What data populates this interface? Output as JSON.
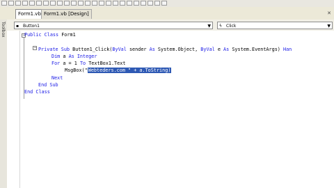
{
  "tabs": [
    {
      "label": "Form1.vb"
    },
    {
      "label": "Form1.vb [Design]"
    }
  ],
  "toolbox": {
    "label": "Toolbox"
  },
  "nav": {
    "left_combo": "Button1",
    "right_combo": "Click"
  },
  "code": {
    "l1_kw": "Public Class",
    "l1_tx": " Form1",
    "l2_kw1": "Private Sub",
    "l2_tx1": " Button1_Click(",
    "l2_kw2": "ByVal",
    "l2_tx2": " sender ",
    "l2_kw3": "As",
    "l2_tx3": " System.Object, ",
    "l2_kw4": "ByVal",
    "l2_tx4": " e ",
    "l2_kw5": "As",
    "l2_tx5": " System.EventArgs) ",
    "l2_kw6": "Han",
    "l3_kw1": "Dim",
    "l3_tx1": " a ",
    "l3_kw2": "As Integer",
    "l4_kw1": "For",
    "l4_tx1": " a = 1 ",
    "l4_kw2": "To",
    "l4_tx2": " TextBox1.Text",
    "l5_tx1": "MsgBox(\"",
    "l5_tx2": "Webteders.com \" + a.ToString)",
    "l6_kw": "Next",
    "l7_kw": "End Sub",
    "l8_kw": "End Class"
  }
}
